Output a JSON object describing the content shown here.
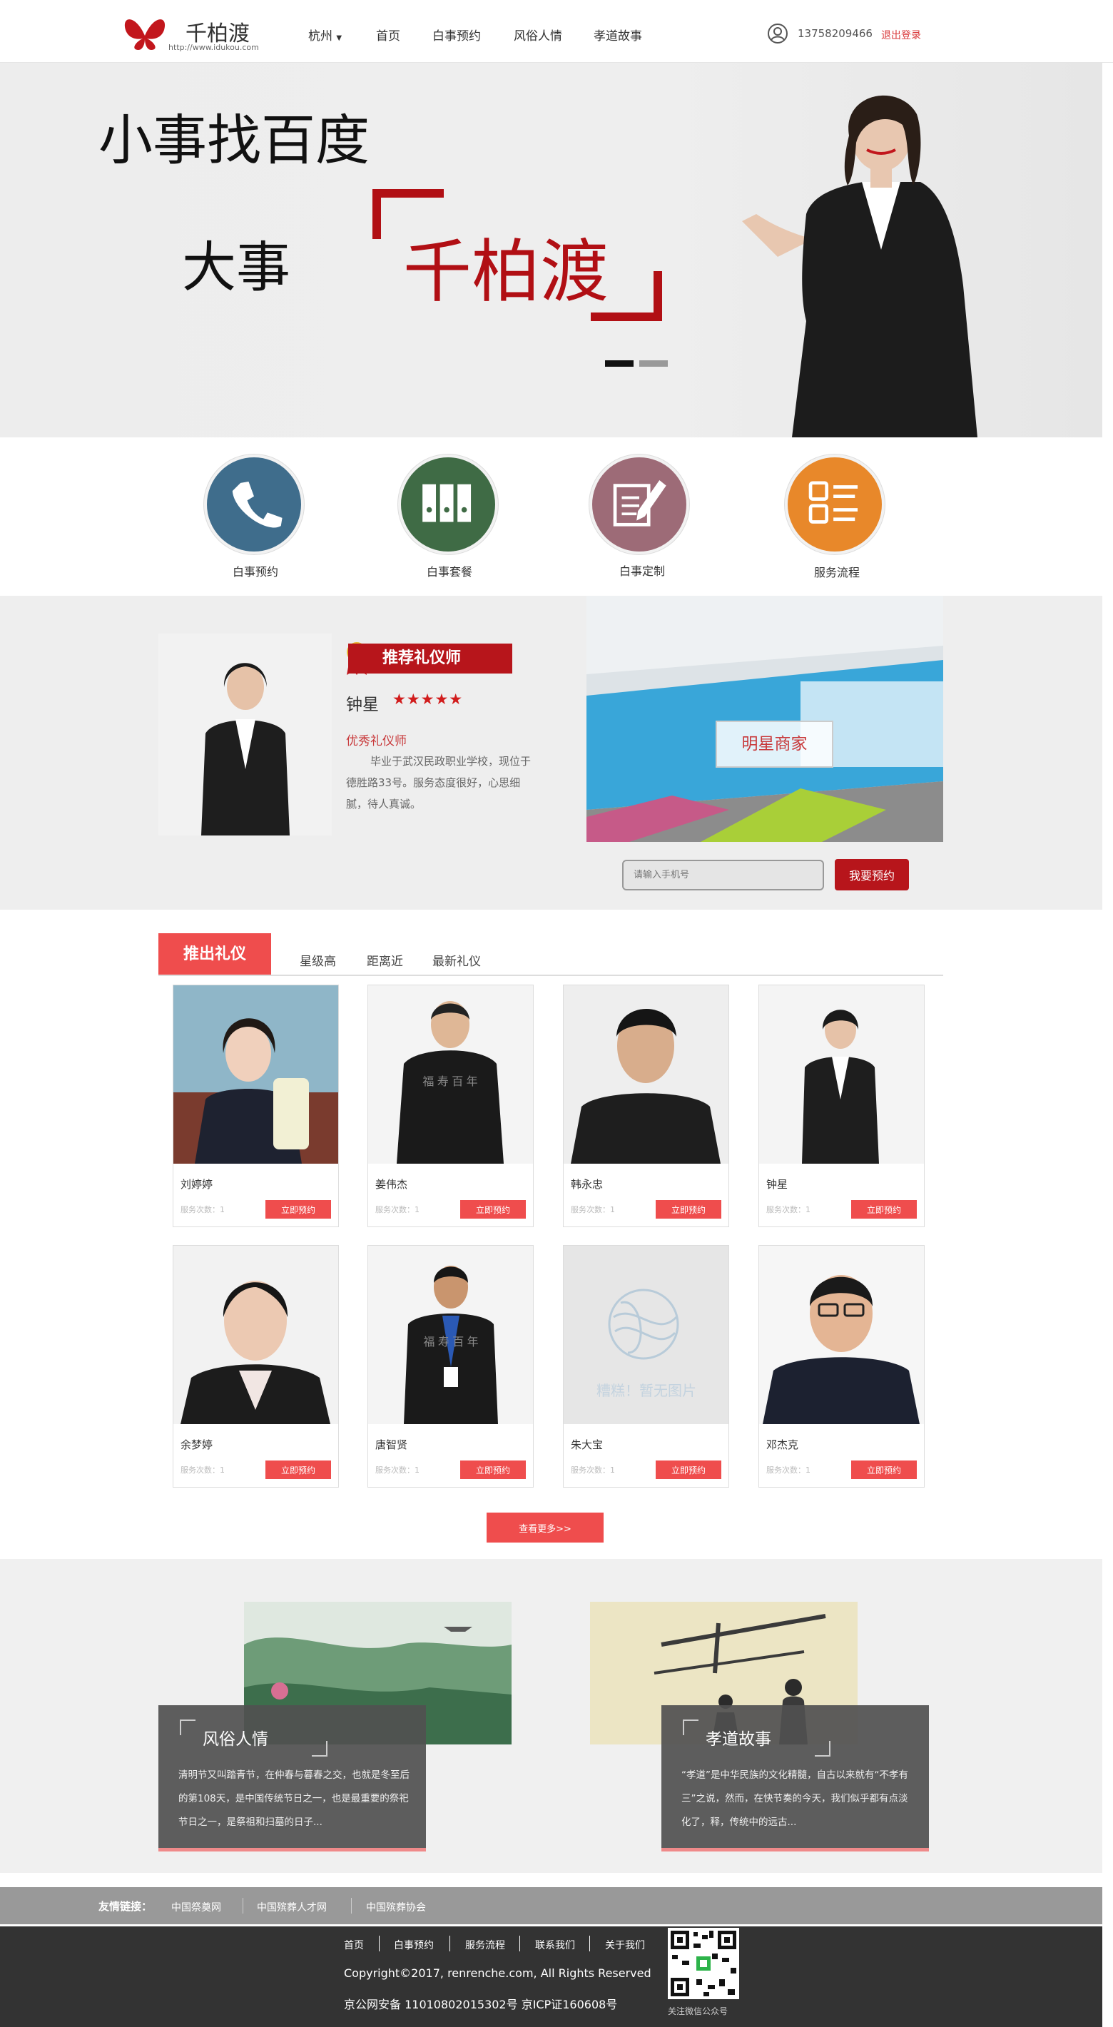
{
  "header": {
    "brand": "千柏渡",
    "brand_url": "http://www.idukou.com",
    "city": "杭州",
    "nav": [
      "首页",
      "白事预约",
      "风俗人情",
      "孝道故事"
    ],
    "phone": "13758209466",
    "logout": "退出登录"
  },
  "banner": {
    "line1": "小事找百度",
    "line2": "大事",
    "brand_big": "千柏渡"
  },
  "services": [
    {
      "label": "白事预约",
      "icon": "phone-icon",
      "color": "#3f6d8c"
    },
    {
      "label": "白事套餐",
      "icon": "binders-icon",
      "color": "#3f6b45"
    },
    {
      "label": "白事定制",
      "icon": "document-pen-icon",
      "color": "#9d6b77"
    },
    {
      "label": "服务流程",
      "icon": "list-icon",
      "color": "#e8882a"
    }
  ],
  "recommend": {
    "badge": "推荐礼仪师",
    "name": "钟星",
    "stars": "★★★★★",
    "title": "优秀礼仪师",
    "desc": "毕业于武汉民政职业学校，现位于德胜路33号。服务态度很好，心思细腻，待人真诚。",
    "store_label": "明星商家",
    "phone_placeholder": "请输入手机号",
    "book_button": "我要预约"
  },
  "list": {
    "active_tab": "推出礼仪",
    "tabs": [
      "星级高",
      "距离近",
      "最新礼仪"
    ],
    "book_label": "立即预约",
    "count_label": "服务次数：1",
    "more_button": "查看更多>>",
    "no_image_text": "糟糕！暂无图片",
    "photo_caption": "福 寿 百 年",
    "cards": [
      {
        "name": "刘婷婷"
      },
      {
        "name": "姜伟杰"
      },
      {
        "name": "韩永忠"
      },
      {
        "name": "钟星"
      },
      {
        "name": "余梦婷"
      },
      {
        "name": "唐智贤"
      },
      {
        "name": "朱大宝"
      },
      {
        "name": "邓杰克"
      }
    ]
  },
  "articles": [
    {
      "title": "风俗人情",
      "text": "清明节又叫踏青节，在仲春与暮春之交，也就是冬至后的第108天，是中国传统节日之一，也是最重要的祭祀节日之一，是祭祖和扫墓的日子..."
    },
    {
      "title": "孝道故事",
      "text": "“孝道”是中华民族的文化精髓，自古以来就有“不孝有三”之说，然而，在快节奏的今天，我们似乎都有点淡化了，释，传统中的远古..."
    }
  ],
  "footer": {
    "links_label": "友情链接：",
    "links": [
      "中国祭奠网",
      "中国殡葬人才网",
      "中国殡葬协会"
    ],
    "nav": [
      "首页",
      "白事预约",
      "服务流程",
      "联系我们",
      "关于我们"
    ],
    "copyright": "Copyright©2017, renrenche.com, All Rights Reserved",
    "icp": "京公网安备 11010802015302号 京ICP证160608号",
    "qr_label": "关注微信公众号"
  }
}
